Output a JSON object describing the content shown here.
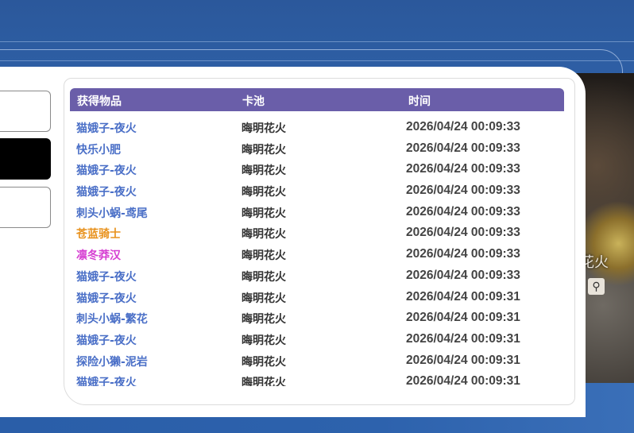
{
  "columns": {
    "item": "获得物品",
    "pool": "卡池",
    "time": "时间"
  },
  "art": {
    "text": "花火",
    "icon": "search-icon"
  },
  "colors": {
    "blue": "#4a6fc7",
    "orange": "#e8921e",
    "magenta": "#d63fd2",
    "header": "#6a5ea9"
  },
  "rows": [
    {
      "item": "猫娥子-夜火",
      "pool": "晦明花火",
      "time": "2026/04/24 00:09:33",
      "color": "#4a6fc7"
    },
    {
      "item": "快乐小肥",
      "pool": "晦明花火",
      "time": "2026/04/24 00:09:33",
      "color": "#4a6fc7"
    },
    {
      "item": "猫娥子-夜火",
      "pool": "晦明花火",
      "time": "2026/04/24 00:09:33",
      "color": "#4a6fc7"
    },
    {
      "item": "猫娥子-夜火",
      "pool": "晦明花火",
      "time": "2026/04/24 00:09:33",
      "color": "#4a6fc7"
    },
    {
      "item": "刺头小蜗-鸢尾",
      "pool": "晦明花火",
      "time": "2026/04/24 00:09:33",
      "color": "#4a6fc7"
    },
    {
      "item": "苍蓝骑士",
      "pool": "晦明花火",
      "time": "2026/04/24 00:09:33",
      "color": "#e8921e"
    },
    {
      "item": "凛冬莽汉",
      "pool": "晦明花火",
      "time": "2026/04/24 00:09:33",
      "color": "#d63fd2"
    },
    {
      "item": "猫娥子-夜火",
      "pool": "晦明花火",
      "time": "2026/04/24 00:09:33",
      "color": "#4a6fc7"
    },
    {
      "item": "猫娥子-夜火",
      "pool": "晦明花火",
      "time": "2026/04/24 00:09:31",
      "color": "#4a6fc7"
    },
    {
      "item": "刺头小蜗-繁花",
      "pool": "晦明花火",
      "time": "2026/04/24 00:09:31",
      "color": "#4a6fc7"
    },
    {
      "item": "猫娥子-夜火",
      "pool": "晦明花火",
      "time": "2026/04/24 00:09:31",
      "color": "#4a6fc7"
    },
    {
      "item": "探险小獭-泥岩",
      "pool": "晦明花火",
      "time": "2026/04/24 00:09:31",
      "color": "#4a6fc7"
    },
    {
      "item": "猫娥子-夜火",
      "pool": "晦明花火",
      "time": "2026/04/24 00:09:31",
      "color": "#4a6fc7"
    }
  ]
}
